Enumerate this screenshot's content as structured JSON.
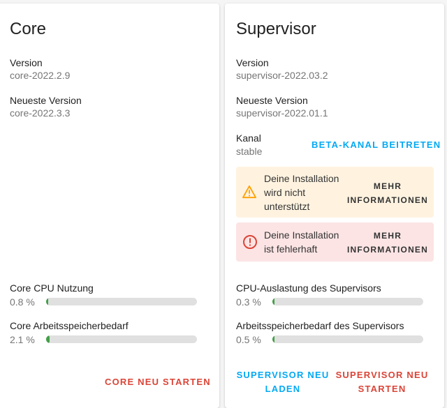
{
  "core": {
    "title": "Core",
    "version_label": "Version",
    "version": "core-2022.2.9",
    "latest_label": "Neueste Version",
    "latest": "core-2022.3.3",
    "cpu_label": "Core CPU Nutzung",
    "cpu_value": "0.8 %",
    "cpu_percent": 0.8,
    "mem_label": "Core Arbeitsspeicherbedarf",
    "mem_value": "2.1 %",
    "mem_percent": 2.1,
    "restart": "CORE NEU STARTEN"
  },
  "supervisor": {
    "title": "Supervisor",
    "version_label": "Version",
    "version": "supervisor-2022.03.2",
    "latest_label": "Neueste Version",
    "latest": "supervisor-2022.01.1",
    "channel_label": "Kanal",
    "channel": "stable",
    "beta_button": "BETA-KANAL BEITRETEN",
    "alerts": [
      {
        "text_lines": [
          "Deine Installation",
          "wird nicht",
          "unterstützt"
        ],
        "more": [
          "MEHR",
          "INFORMATIONEN"
        ],
        "bg": "#fff3e0",
        "icon_color": "#ffa000"
      },
      {
        "text_lines": [
          "Deine Installation",
          "ist fehlerhaft"
        ],
        "more": [
          "MEHR",
          "INFORMATIONEN"
        ],
        "bg": "#fce4e4",
        "icon_color": "#db4437"
      }
    ],
    "cpu_label": "CPU-Auslastung des Supervisors",
    "cpu_value": "0.3 %",
    "cpu_percent": 0.3,
    "mem_label": "Arbeitsspeicherbedarf des Supervisors",
    "mem_value": "0.5 %",
    "mem_percent": 0.5,
    "reload": [
      "SUPERVISOR NEU",
      "LADEN"
    ],
    "restart": [
      "SUPERVISOR NEU",
      "STARTEN"
    ]
  },
  "colors": {
    "primary": "#03a9f4",
    "danger": "#db4437",
    "bar_fill": "#43a047"
  }
}
